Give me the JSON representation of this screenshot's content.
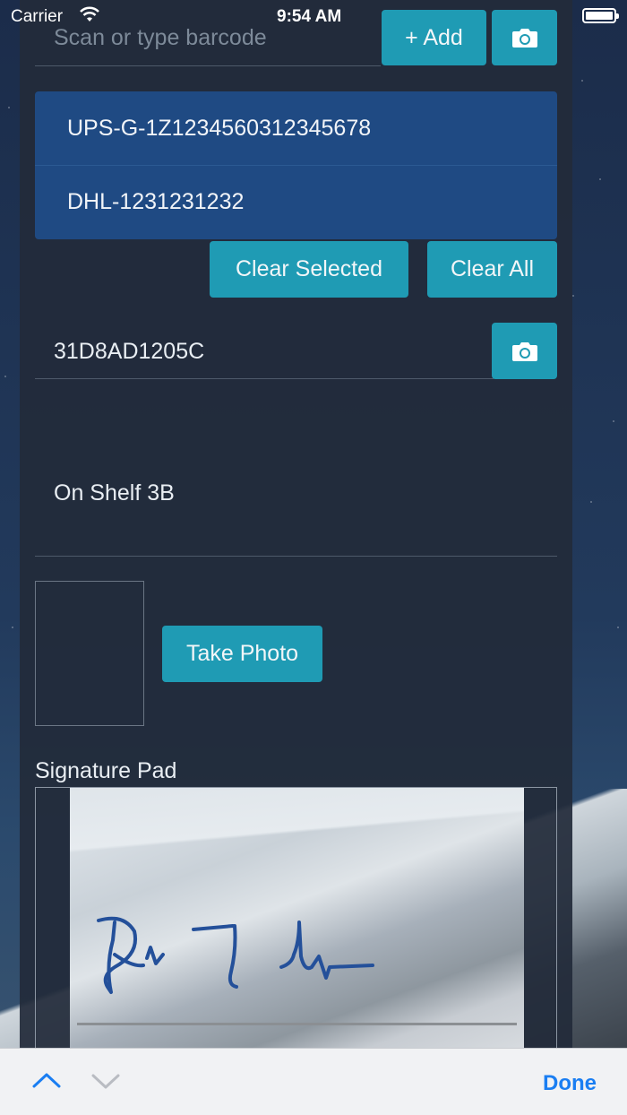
{
  "status_bar": {
    "carrier": "Carrier",
    "time": "9:54 AM"
  },
  "barcode_field": {
    "placeholder": "Scan or type barcode"
  },
  "buttons": {
    "add": "+ Add",
    "clear_selected": "Clear Selected",
    "clear_all": "Clear All",
    "take_photo": "Take Photo",
    "done": "Done"
  },
  "tracking_list": [
    "UPS-G-1Z1234560312345678",
    "DHL-1231231232"
  ],
  "id_field": {
    "value": "31D8AD1205C"
  },
  "location_text": "On Shelf 3B",
  "signature": {
    "label": "Signature Pad"
  },
  "icons": {
    "camera": "camera-icon",
    "prev": "chevron-up-icon",
    "next": "chevron-down-icon",
    "wifi": "wifi-icon",
    "battery": "battery-icon"
  },
  "colors": {
    "accent": "#1f9bb4",
    "list_bg": "#1f4a83",
    "done": "#1a7ef2"
  }
}
